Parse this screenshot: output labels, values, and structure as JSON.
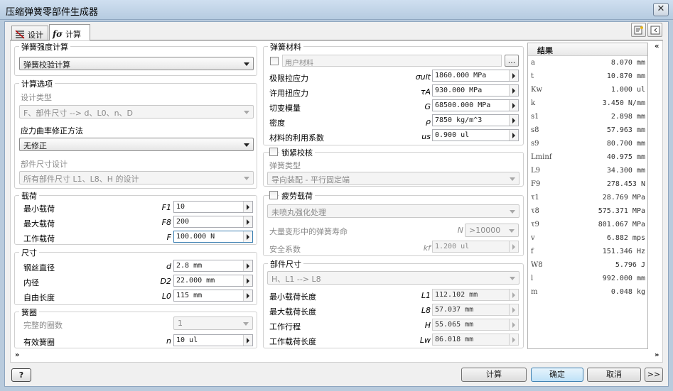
{
  "window": {
    "title": "压缩弹簧零部件生成器",
    "close": "✕"
  },
  "tabs": [
    {
      "label": "设计"
    },
    {
      "label": "计算"
    }
  ],
  "strength": {
    "legend": "弹簧强度计算",
    "mode": "弹簧校验计算"
  },
  "options": {
    "legend": "计算选项",
    "design_type_label": "设计类型",
    "design_type_value": "F、部件尺寸 --> d、L0、n、D",
    "stress_label": "应力曲率修正方法",
    "stress_value": "无修正",
    "size_label": "部件尺寸设计",
    "size_value": "所有部件尺寸 L1、L8、H 的设计"
  },
  "loads": {
    "legend": "载荷",
    "rows": [
      {
        "label": "最小载荷",
        "sym": "F1",
        "value": "10"
      },
      {
        "label": "最大载荷",
        "sym": "F8",
        "value": "200"
      },
      {
        "label": "工作载荷",
        "sym": "F",
        "value": "100.000 N"
      }
    ]
  },
  "dims": {
    "legend": "尺寸",
    "rows": [
      {
        "label": "钢丝直径",
        "sym": "d",
        "value": "2.8 mm"
      },
      {
        "label": "内径",
        "sym": "D2",
        "value": "22.000 mm"
      },
      {
        "label": "自由长度",
        "sym": "L0",
        "value": "115 mm"
      }
    ]
  },
  "coils": {
    "legend": "簧圈",
    "full_label": "完整的圈数",
    "full_value": "1",
    "active_label": "有效簧圈",
    "active_sym": "n",
    "active_value": "10 ul"
  },
  "material": {
    "legend": "弹簧材料",
    "user_label": "用户材料",
    "browse": "...",
    "rows": [
      {
        "label": "极限拉应力",
        "sym": "σult",
        "value": "1860.000 MPa"
      },
      {
        "label": "许用扭应力",
        "sym": "τA",
        "value": "930.000 MPa"
      },
      {
        "label": "切变模量",
        "sym": "G",
        "value": "68500.000 MPa"
      },
      {
        "label": "密度",
        "sym": "ρ",
        "value": "7850 kg/m^3"
      },
      {
        "label": "材料的利用系数",
        "sym": "us",
        "value": "0.900 ul"
      }
    ]
  },
  "buckle": {
    "legend": "锁紧校核",
    "type_label": "弹簧类型",
    "type_value": "导向装配 - 平行固定端"
  },
  "fatigue": {
    "legend": "疲劳载荷",
    "treat_value": "未喷丸强化处理",
    "life_label": "大量变形中的弹簧寿命",
    "life_sym": "N",
    "life_value": ">10000",
    "safety_label": "安全系数",
    "safety_sym": "kf",
    "safety_value": "1.200 ul"
  },
  "compsize": {
    "legend": "部件尺寸",
    "mode": "H、L1 --> L8",
    "rows": [
      {
        "label": "最小载荷长度",
        "sym": "L1",
        "value": "112.102 mm"
      },
      {
        "label": "最大载荷长度",
        "sym": "L8",
        "value": "57.037 mm"
      },
      {
        "label": "工作行程",
        "sym": "H",
        "value": "55.065 mm"
      },
      {
        "label": "工作载荷长度",
        "sym": "Lw",
        "value": "86.018 mm"
      }
    ]
  },
  "results": {
    "title": "结果",
    "rows": [
      {
        "k": "a",
        "v": "8.070 mm"
      },
      {
        "k": "t",
        "v": "10.870 mm"
      },
      {
        "k": "Kw",
        "v": "1.000 ul"
      },
      {
        "k": "k",
        "v": "3.450 N/mm"
      },
      {
        "k": "s1",
        "v": "2.898 mm"
      },
      {
        "k": "s8",
        "v": "57.963 mm"
      },
      {
        "k": "s9",
        "v": "80.700 mm"
      },
      {
        "k": "Lminf",
        "v": "40.975 mm"
      },
      {
        "k": "L9",
        "v": "34.300 mm"
      },
      {
        "k": "F9",
        "v": "278.453 N"
      },
      {
        "k": "τ1",
        "v": "28.769 MPa"
      },
      {
        "k": "τ8",
        "v": "575.371 MPa"
      },
      {
        "k": "τ9",
        "v": "801.067 MPa"
      },
      {
        "k": "v",
        "v": "6.882 mps"
      },
      {
        "k": "f",
        "v": "151.346 Hz"
      },
      {
        "k": "W8",
        "v": "5.796 J"
      },
      {
        "k": "l",
        "v": "992.000 mm"
      },
      {
        "k": "m",
        "v": "0.048 kg"
      }
    ]
  },
  "footer": {
    "help": "?",
    "calc": "计算",
    "ok": "确定",
    "cancel": "取消",
    "more": ">>"
  },
  "colors": {
    "accent": "#3c7fb1",
    "frame": "#b9cbdd"
  }
}
